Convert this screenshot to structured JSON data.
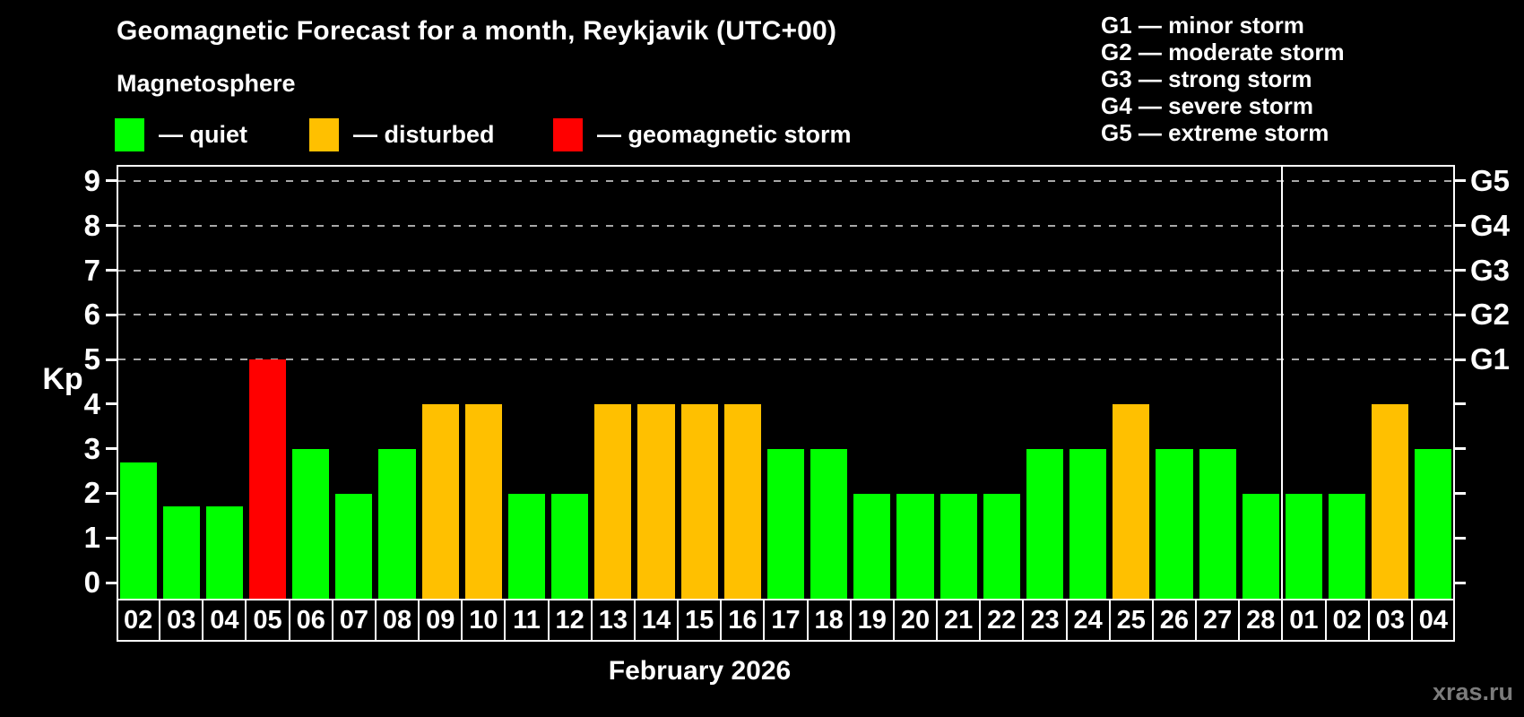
{
  "header": {
    "title": "Geomagnetic Forecast for a month, Reykjavik (UTC+00)",
    "subtitle": "Magnetosphere",
    "legend": [
      {
        "name": "quiet",
        "label": "— quiet",
        "color": "#00ff00"
      },
      {
        "name": "disturbed",
        "label": "— disturbed",
        "color": "#ffc000"
      },
      {
        "name": "geomagnetic-storm",
        "label": "— geomagnetic storm",
        "color": "#ff0000"
      }
    ],
    "g_scale_legend": [
      "G1 — minor storm",
      "G2 — moderate storm",
      "G3 — strong storm",
      "G4 — severe storm",
      "G5 — extreme storm"
    ]
  },
  "axes": {
    "y_label": "Kp",
    "y_ticks": [
      "0",
      "1",
      "2",
      "3",
      "4",
      "5",
      "6",
      "7",
      "8",
      "9"
    ],
    "right_ticks": [
      {
        "label": "G1",
        "kp": 5
      },
      {
        "label": "G2",
        "kp": 6
      },
      {
        "label": "G3",
        "kp": 7
      },
      {
        "label": "G4",
        "kp": 8
      },
      {
        "label": "G5",
        "kp": 9
      }
    ],
    "x_title": "February 2026"
  },
  "chart_data": {
    "type": "bar",
    "title": "Geomagnetic Forecast for a month, Reykjavik (UTC+00)",
    "xlabel": "February 2026",
    "ylabel": "Kp",
    "ylim": [
      0,
      9
    ],
    "grid": "horizontal dashed gridlines at Kp 5,6,7,8,9 (G1–G5 levels)",
    "legend_position": "top-left",
    "categories": [
      "02",
      "03",
      "04",
      "05",
      "06",
      "07",
      "08",
      "09",
      "10",
      "11",
      "12",
      "13",
      "14",
      "15",
      "16",
      "17",
      "18",
      "19",
      "20",
      "21",
      "22",
      "23",
      "24",
      "25",
      "26",
      "27",
      "28",
      "01",
      "02",
      "03",
      "04"
    ],
    "values": [
      2.7,
      1.7,
      1.7,
      5,
      3,
      2,
      3,
      4,
      4,
      2,
      2,
      4,
      4,
      4,
      4,
      3,
      3,
      2,
      2,
      2,
      2,
      3,
      3,
      4,
      3,
      3,
      2,
      2,
      2,
      4,
      3
    ],
    "statuses": [
      "quiet",
      "quiet",
      "quiet",
      "storm",
      "quiet",
      "quiet",
      "quiet",
      "disturbed",
      "disturbed",
      "quiet",
      "quiet",
      "disturbed",
      "disturbed",
      "disturbed",
      "disturbed",
      "quiet",
      "quiet",
      "quiet",
      "quiet",
      "quiet",
      "quiet",
      "quiet",
      "quiet",
      "disturbed",
      "quiet",
      "quiet",
      "quiet",
      "quiet",
      "quiet",
      "disturbed",
      "quiet"
    ],
    "colors": {
      "quiet": "#00ff00",
      "disturbed": "#ffc000",
      "storm": "#ff0000"
    },
    "month_separator_after_index": 26
  },
  "watermark": "xras.ru"
}
